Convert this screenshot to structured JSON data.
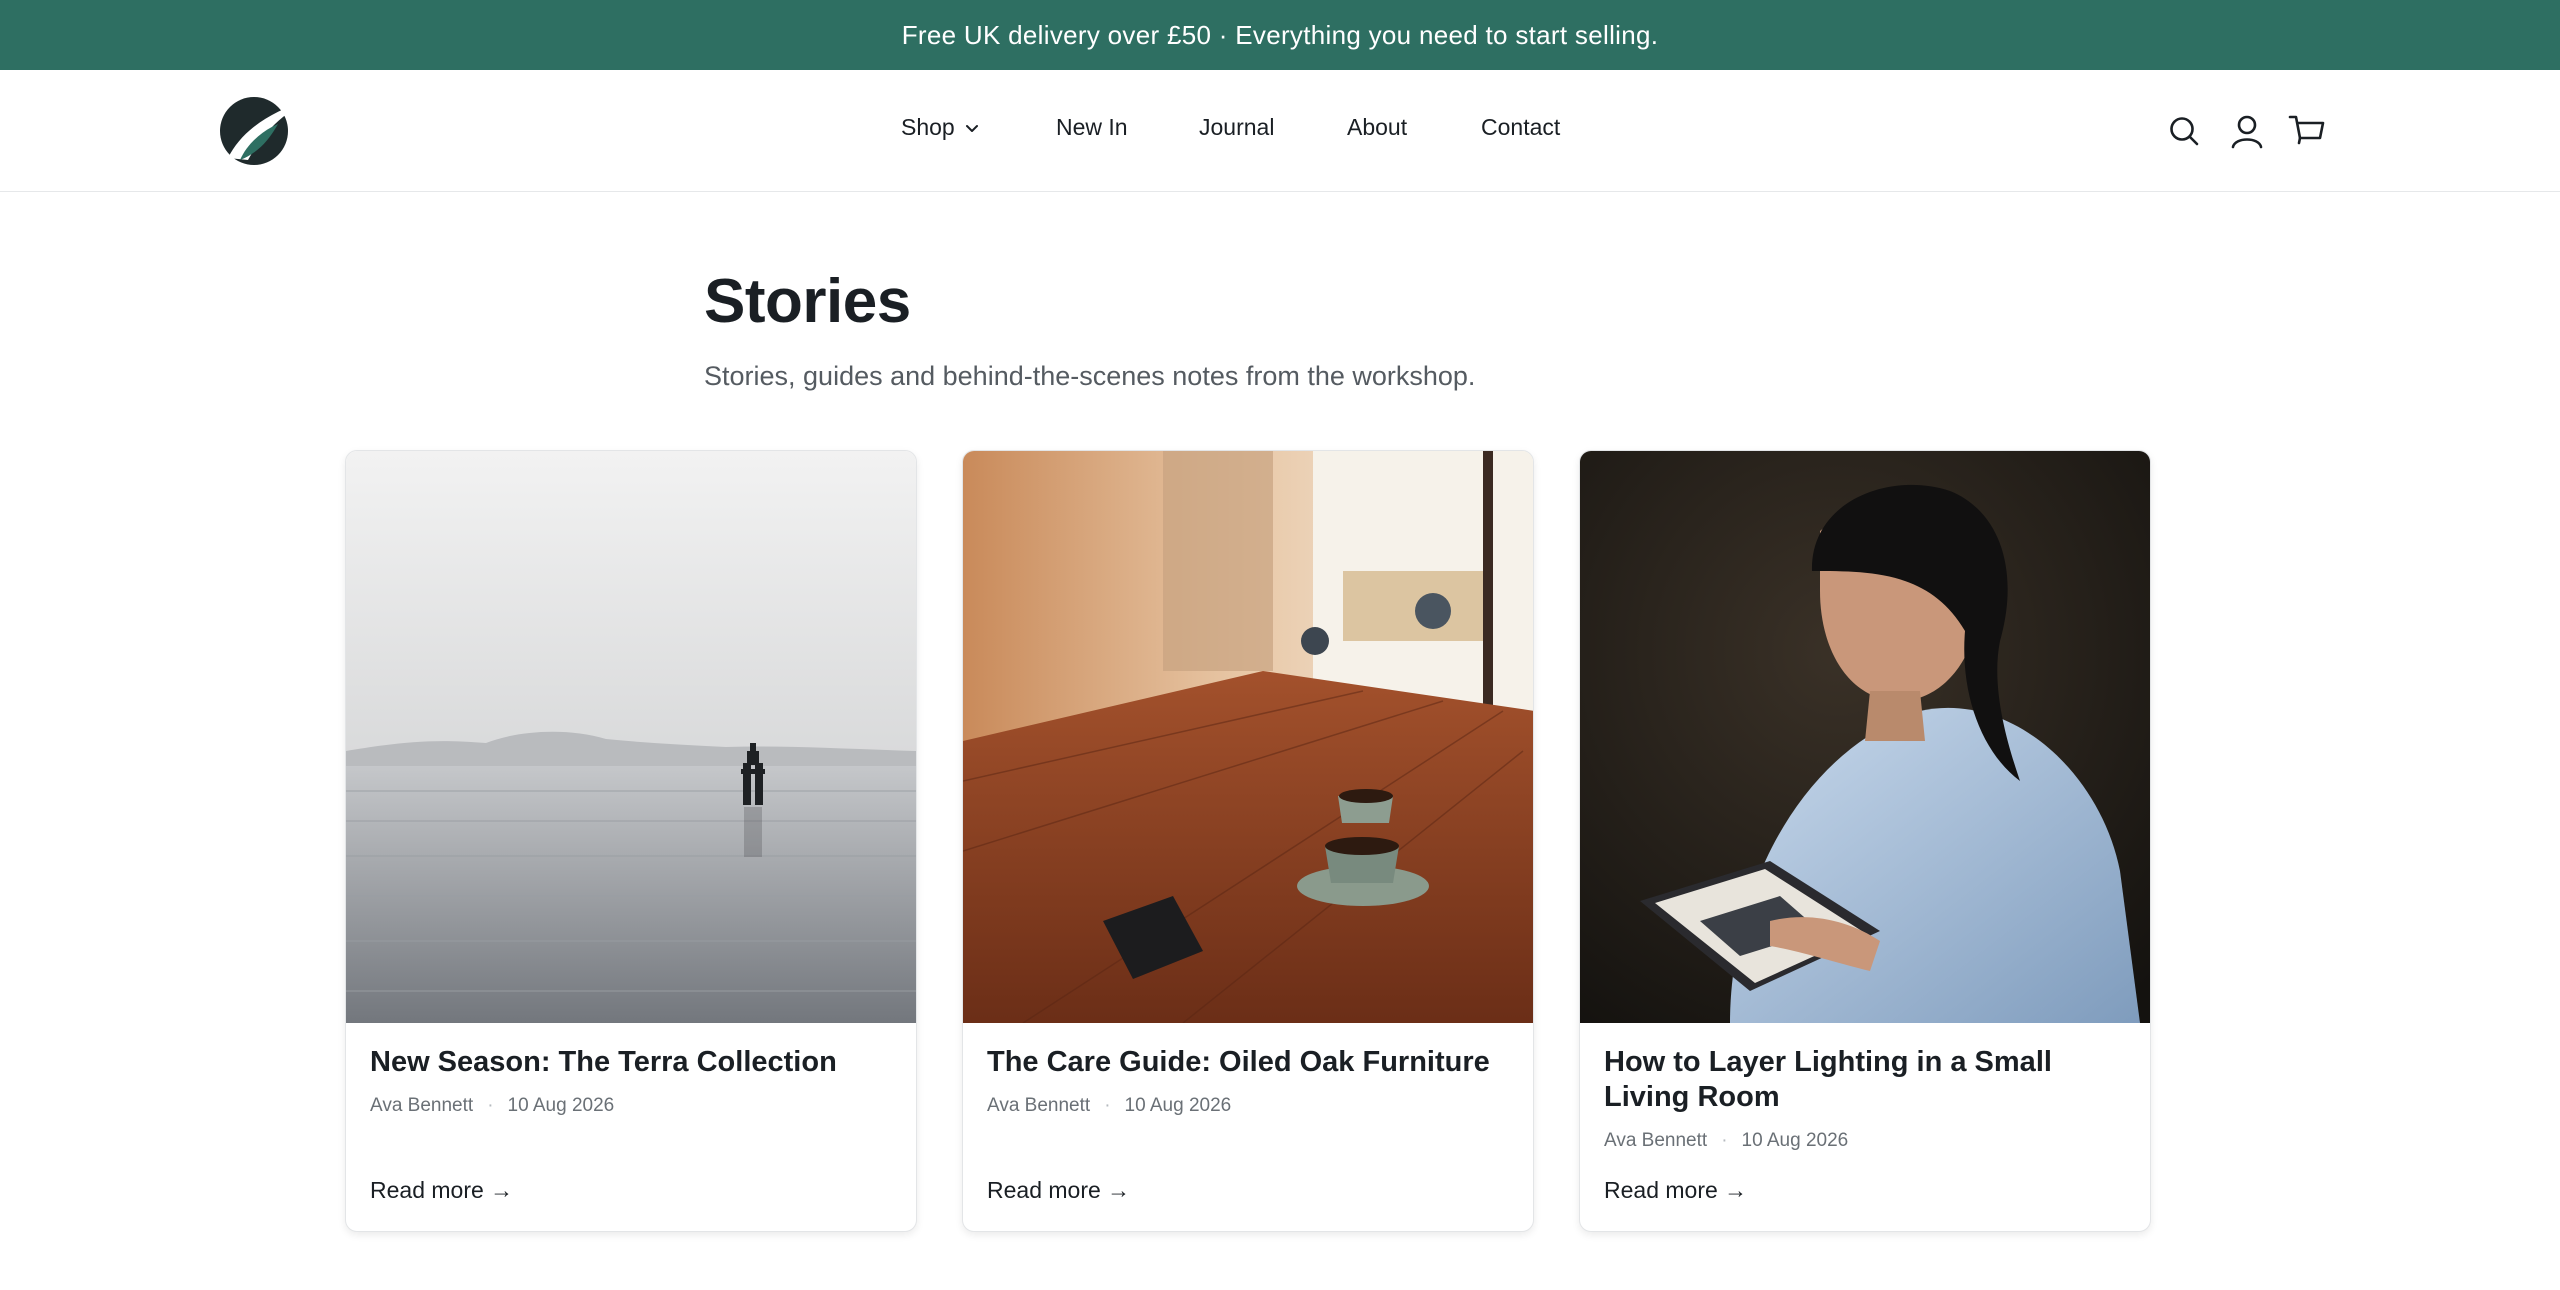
{
  "announcement": "Free UK delivery over £50 · Everything you need to start selling.",
  "colors": {
    "brand": "#2e6f62",
    "text": "#1a1f24",
    "muted": "#555b61"
  },
  "header": {
    "logo_icon": "leaf-logo-icon",
    "nav": [
      {
        "label": "Shop",
        "has_dropdown": true
      },
      {
        "label": "New In"
      },
      {
        "label": "Journal"
      },
      {
        "label": "About"
      },
      {
        "label": "Contact"
      }
    ],
    "icons": [
      "search-icon",
      "account-icon",
      "cart-icon"
    ]
  },
  "page": {
    "title": "Stories",
    "subtitle": "Stories, guides and behind-the-scenes notes from the workshop."
  },
  "cards": [
    {
      "image": "sea-buoy-image",
      "title": "New Season: The Terra Collection",
      "author": "Ava Bennett",
      "date": "10 Aug 2026",
      "cta": "Read more →"
    },
    {
      "image": "cafe-table-coffee-image",
      "title": "The Care Guide: Oiled Oak Furniture",
      "author": "Ava Bennett",
      "date": "10 Aug 2026",
      "cta": "Read more →"
    },
    {
      "image": "woman-reading-image",
      "title": "How to Layer Lighting in a Small Living Room",
      "author": "Ava Bennett",
      "date": "10 Aug 2026",
      "cta": "Read more →"
    }
  ]
}
